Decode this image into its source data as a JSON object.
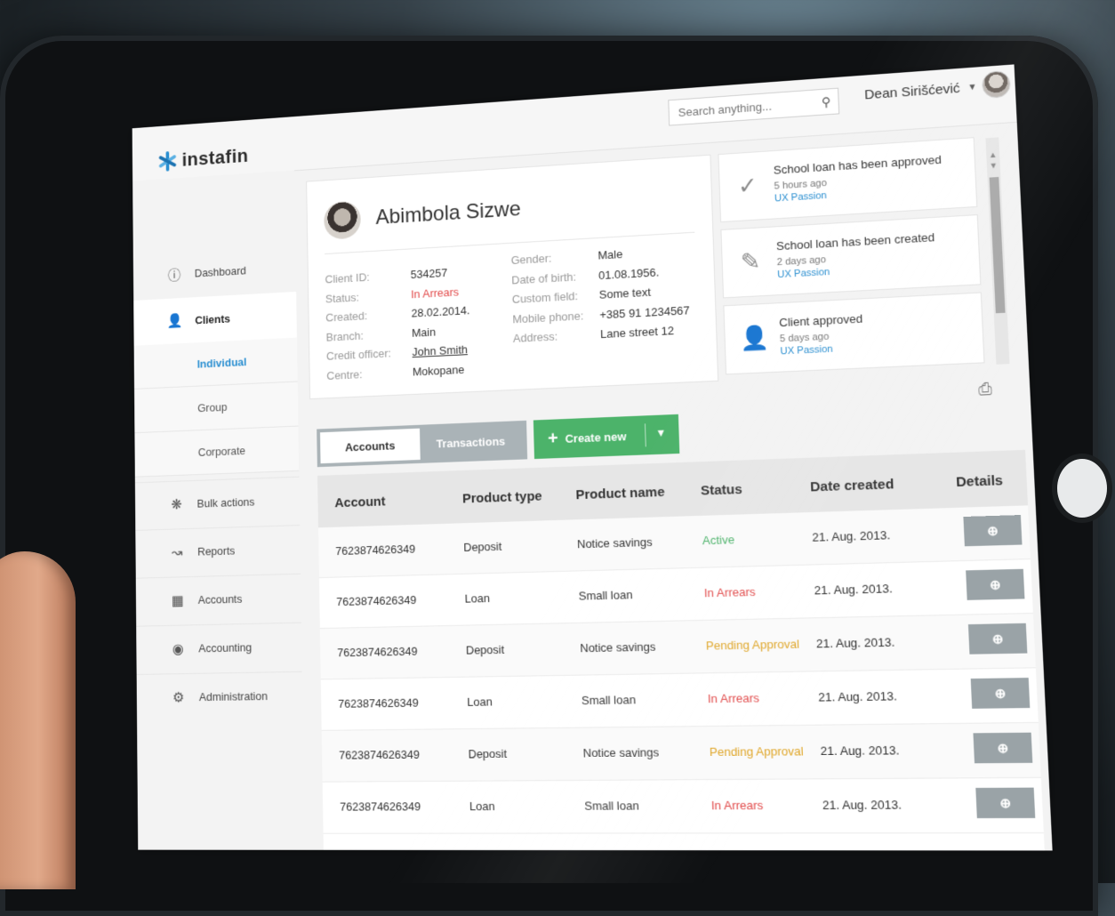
{
  "header": {
    "logo_text": "instafin",
    "search_placeholder": "Search anything...",
    "user_name": "Dean Sirišćević"
  },
  "sidebar": {
    "items": [
      {
        "label": "Dashboard",
        "icon": "info-icon"
      },
      {
        "label": "Clients",
        "icon": "user-icon"
      },
      {
        "label": "Bulk actions",
        "icon": "cluster-icon"
      },
      {
        "label": "Reports",
        "icon": "chart-icon"
      },
      {
        "label": "Accounts",
        "icon": "bank-icon"
      },
      {
        "label": "Accounting",
        "icon": "coins-icon"
      },
      {
        "label": "Administration",
        "icon": "gear-icon"
      }
    ],
    "sub_items": [
      "Individual",
      "Group",
      "Corporate"
    ]
  },
  "client": {
    "name": "Abimbola Sizwe",
    "fields_left": [
      {
        "key": "Client ID:",
        "value": "534257"
      },
      {
        "key": "Status:",
        "value": "In Arrears"
      },
      {
        "key": "Created:",
        "value": "28.02.2014."
      },
      {
        "key": "Branch:",
        "value": "Main"
      },
      {
        "key": "Credit officer:",
        "value": "John Smith"
      },
      {
        "key": "Centre:",
        "value": "Mokopane"
      }
    ],
    "fields_right": [
      {
        "key": "Gender:",
        "value": "Male"
      },
      {
        "key": "Date of birth:",
        "value": "01.08.1956."
      },
      {
        "key": "Custom field:",
        "value": "Some text"
      },
      {
        "key": "Mobile phone:",
        "value": "+385 91 1234567"
      },
      {
        "key": "Address:",
        "value": "Lane street 12"
      }
    ]
  },
  "notifications": [
    {
      "title": "School loan has been approved",
      "ago": "5 hours ago",
      "by": "UX Passion",
      "icon": "check-icon"
    },
    {
      "title": "School loan has been created",
      "ago": "2 days ago",
      "by": "UX Passion",
      "icon": "edit-icon"
    },
    {
      "title": "Client approved",
      "ago": "5 days ago",
      "by": "UX Passion",
      "icon": "user-icon"
    }
  ],
  "tabs": [
    "Accounts",
    "Transactions"
  ],
  "create_label": "Create new",
  "table": {
    "columns": [
      "Account",
      "Product type",
      "Product name",
      "Status",
      "Date created",
      "Details"
    ],
    "rows": [
      [
        "7623874626349",
        "Deposit",
        "Notice savings",
        "Active",
        "21. Aug. 2013."
      ],
      [
        "7623874626349",
        "Loan",
        "Small loan",
        "In Arrears",
        "21. Aug. 2013."
      ],
      [
        "7623874626349",
        "Deposit",
        "Notice savings",
        "Pending Approval",
        "21. Aug. 2013."
      ],
      [
        "7623874626349",
        "Loan",
        "Small loan",
        "In Arrears",
        "21. Aug. 2013."
      ],
      [
        "7623874626349",
        "Deposit",
        "Notice savings",
        "Pending Approval",
        "21. Aug. 2013."
      ],
      [
        "7623874626349",
        "Loan",
        "Small loan",
        "In Arrears",
        "21. Aug. 2013."
      ]
    ]
  },
  "colors": {
    "accent": "#2a8fd1",
    "create": "#4cb36a",
    "active": "#4cb36a",
    "arrears": "#e24b4b",
    "pending": "#e0a72a"
  }
}
